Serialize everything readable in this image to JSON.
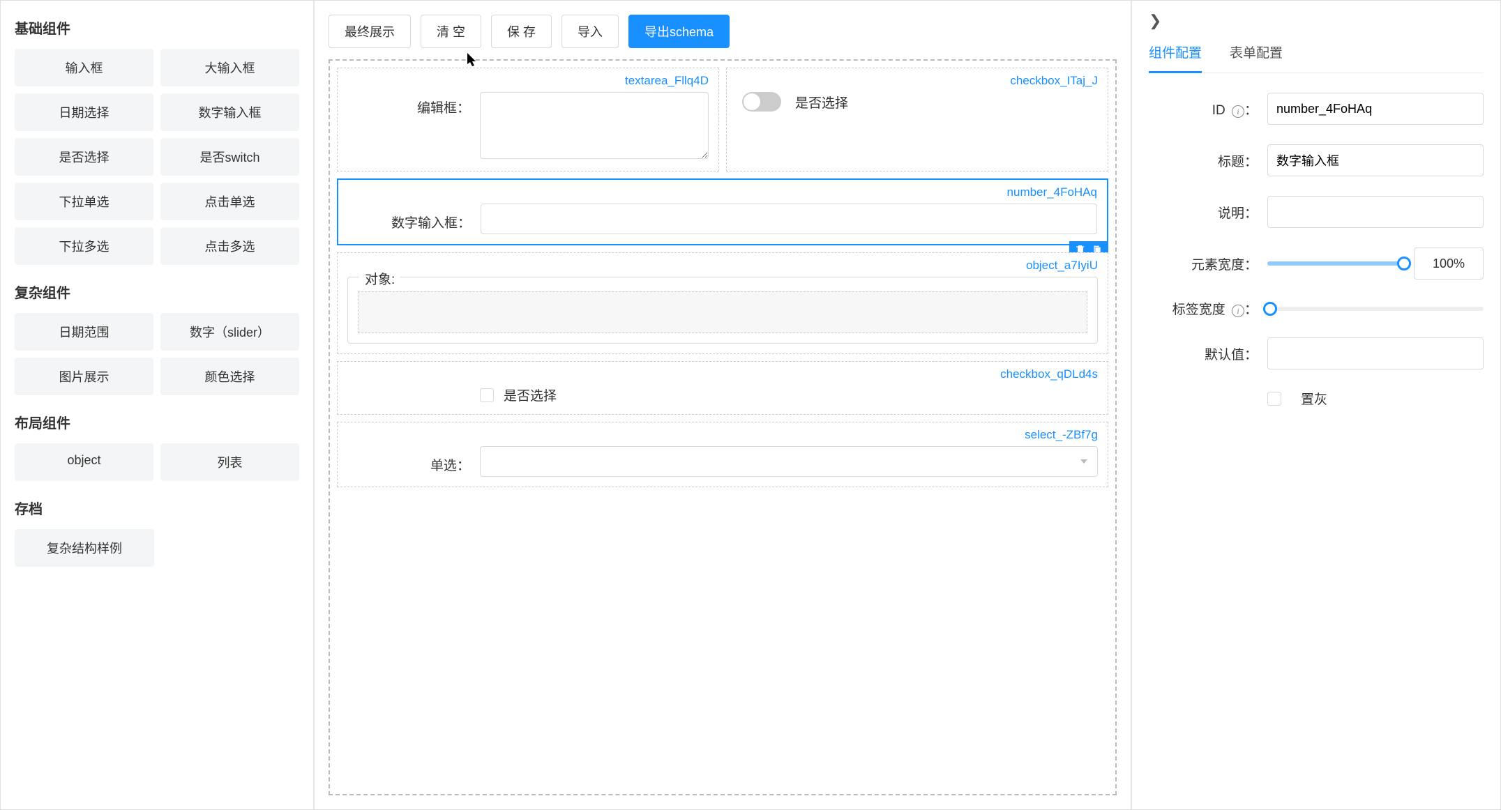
{
  "sidebar": {
    "sections": [
      {
        "title": "基础组件",
        "items": [
          "输入框",
          "大输入框",
          "日期选择",
          "数字输入框",
          "是否选择",
          "是否switch",
          "下拉单选",
          "点击单选",
          "下拉多选",
          "点击多选"
        ]
      },
      {
        "title": "复杂组件",
        "items": [
          "日期范围",
          "数字（slider）",
          "图片展示",
          "颜色选择"
        ]
      },
      {
        "title": "布局组件",
        "items": [
          "object",
          "列表"
        ]
      },
      {
        "title": "存档",
        "single": "复杂结构样例"
      }
    ]
  },
  "toolbar": {
    "preview": "最终展示",
    "clear": "清 空",
    "save": "保 存",
    "import": "导入",
    "export": "导出schema"
  },
  "canvas": {
    "textarea": {
      "id": "textarea_Fllq4D",
      "label": "编辑框："
    },
    "switch": {
      "id": "checkbox_ITaj_J",
      "label": "是否选择"
    },
    "number": {
      "id": "number_4FoHAq",
      "label": "数字输入框："
    },
    "object": {
      "id": "object_a7IyiU",
      "legend": "对象:"
    },
    "checkbox": {
      "id": "checkbox_qDLd4s",
      "label": "是否选择"
    },
    "select": {
      "id": "select_-ZBf7g",
      "label": "单选："
    }
  },
  "panel": {
    "tabs": {
      "component": "组件配置",
      "form": "表单配置"
    },
    "fields": {
      "id_label": "ID",
      "id_value": "number_4FoHAq",
      "title_label": "标题：",
      "title_value": "数字输入框",
      "desc_label": "说明：",
      "desc_value": "",
      "width_label": "元素宽度：",
      "width_value": "100%",
      "labelwidth_label": "标签宽度",
      "default_label": "默认值：",
      "default_value": "",
      "disabled_label": "置灰"
    }
  }
}
